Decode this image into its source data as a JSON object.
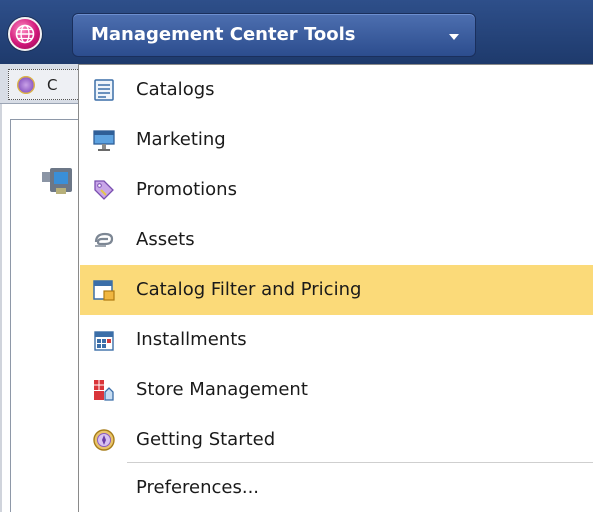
{
  "header": {
    "menu_button_label": "Management Center Tools",
    "globe_icon": "globe-icon",
    "dropdown_icon": "triangle-down-icon"
  },
  "background": {
    "tab_label_partial": "C"
  },
  "menu": {
    "items": [
      {
        "label": "Catalogs",
        "icon": "catalogs-icon"
      },
      {
        "label": "Marketing",
        "icon": "marketing-icon"
      },
      {
        "label": "Promotions",
        "icon": "promotions-icon"
      },
      {
        "label": "Assets",
        "icon": "assets-icon"
      },
      {
        "label": "Catalog Filter and Pricing",
        "icon": "catalog-filter-icon",
        "highlighted": true
      },
      {
        "label": "Installments",
        "icon": "installments-icon"
      },
      {
        "label": "Store Management",
        "icon": "store-management-icon"
      },
      {
        "label": "Getting Started",
        "icon": "getting-started-icon"
      }
    ],
    "preferences_label": "Preferences..."
  },
  "colors": {
    "header_bg": "#1e3a6c",
    "menu_button_bg": "#2c4d8e",
    "highlight": "#fbda79",
    "globe": "#d1187a"
  }
}
